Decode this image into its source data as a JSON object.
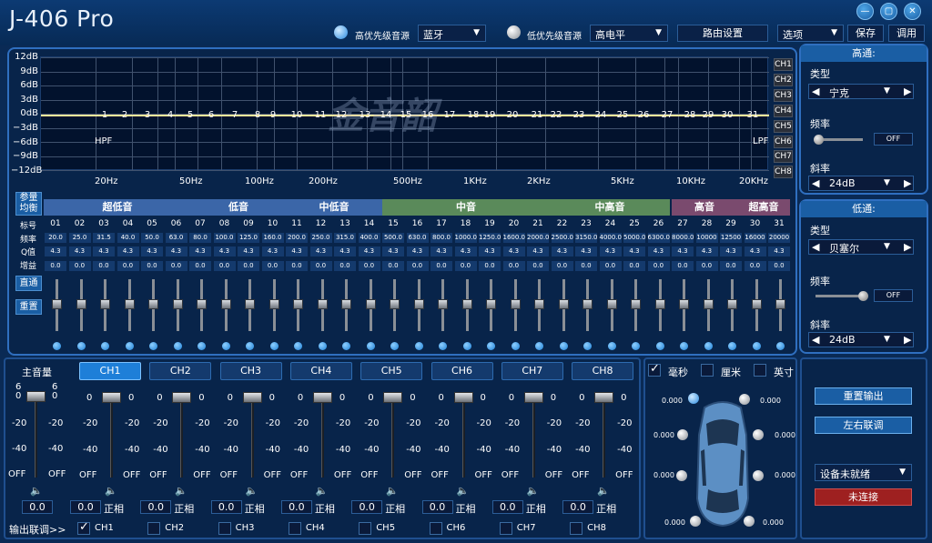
{
  "app": {
    "title": "J-406 Pro",
    "minimize": "—",
    "restore": "▢",
    "close": "✕"
  },
  "top": {
    "high_priority_label": "高优先级音源",
    "high_priority_value": "蓝牙",
    "low_priority_label": "低优先级音源",
    "low_priority_value": "高电平",
    "routing": "路由设置",
    "options": "选项",
    "save": "保存",
    "load": "调用"
  },
  "graph": {
    "watermark": "金音韶",
    "ylabels": [
      "12dB",
      "9dB",
      "6dB",
      "3dB",
      "0dB",
      "−3dB",
      "−6dB",
      "−9dB",
      "−12dB"
    ],
    "hpf": "HPF",
    "lpf": "LPF",
    "bands": [
      "1",
      "2",
      "3",
      "4",
      "5",
      "6",
      "7",
      "8",
      "9",
      "10",
      "11",
      "12",
      "13",
      "14",
      "15",
      "16",
      "17",
      "18",
      "19",
      "20",
      "21",
      "22",
      "23",
      "24",
      "25",
      "26",
      "27",
      "28",
      "29",
      "30",
      "31"
    ],
    "xlabels": [
      "20Hz",
      "50Hz",
      "100Hz",
      "200Hz",
      "500Hz",
      "1KHz",
      "2KHz",
      "5KHz",
      "10KHz",
      "20KHz"
    ],
    "channels": [
      "CH1",
      "CH2",
      "CH3",
      "CH4",
      "CH5",
      "CH6",
      "CH7",
      "CH8"
    ]
  },
  "eq": {
    "param_btn": "参量均衡",
    "direct_btn": "直通",
    "reset_btn": "重置",
    "groups": [
      "超低音",
      "低音",
      "中低音",
      "中音",
      "中高音",
      "高音",
      "超高音"
    ],
    "group_colors": [
      "#3b66a8",
      "#3b66a8",
      "#3b66a8",
      "#5a8a5a",
      "#5a8a5a",
      "#7a4a6e",
      "#7a4a6e"
    ],
    "row_labels": [
      "标号",
      "频率",
      "Q值",
      "增益"
    ],
    "numbers": [
      "01",
      "02",
      "03",
      "04",
      "05",
      "06",
      "07",
      "08",
      "09",
      "10",
      "11",
      "12",
      "13",
      "14",
      "15",
      "16",
      "17",
      "18",
      "19",
      "20",
      "21",
      "22",
      "23",
      "24",
      "25",
      "26",
      "27",
      "28",
      "29",
      "30",
      "31"
    ],
    "freqs": [
      "20.0",
      "25.0",
      "31.5",
      "40.0",
      "50.0",
      "63.0",
      "80.0",
      "100.0",
      "125.0",
      "160.0",
      "200.0",
      "250.0",
      "315.0",
      "400.0",
      "500.0",
      "630.0",
      "800.0",
      "1000.0",
      "1250.0",
      "1600.0",
      "2000.0",
      "2500.0",
      "3150.0",
      "4000.0",
      "5000.0",
      "6300.0",
      "8000.0",
      "10000",
      "12500",
      "16000",
      "20000"
    ],
    "q": "4.3",
    "gain": "0.0"
  },
  "highpass": {
    "title": "高通:",
    "type_label": "类型",
    "type_value": "宁克",
    "freq_label": "频率",
    "freq_value": "OFF",
    "slope_label": "斜率",
    "slope_value": "24dB"
  },
  "lowpass": {
    "title": "低通:",
    "type_label": "类型",
    "type_value": "贝塞尔",
    "freq_label": "频率",
    "freq_value": "OFF",
    "slope_label": "斜率",
    "slope_value": "24dB"
  },
  "mixer": {
    "master_label": "主音量",
    "master_value": "0.0",
    "master_scale": [
      "6",
      "0",
      "-20",
      "-40",
      "OFF"
    ],
    "scale": [
      "0",
      "-20",
      "-40",
      "OFF"
    ],
    "channels": [
      "CH1",
      "CH2",
      "CH3",
      "CH4",
      "CH5",
      "CH6",
      "CH7",
      "CH8"
    ],
    "values": [
      "0.0",
      "0.0",
      "0.0",
      "0.0",
      "0.0",
      "0.0",
      "0.0",
      "0.0"
    ],
    "phase": "正相",
    "link_label": "输出联调>>",
    "link_checks": [
      "CH1",
      "CH2",
      "CH3",
      "CH4",
      "CH5",
      "CH6",
      "CH7",
      "CH8"
    ]
  },
  "delay": {
    "units": [
      "毫秒",
      "厘米",
      "英寸"
    ],
    "values": [
      "0.000",
      "0.000",
      "0.000",
      "0.000",
      "0.000",
      "0.000",
      "0.000",
      "0.000",
      "0.000",
      "0.000"
    ]
  },
  "device": {
    "reset_output": "重置输出",
    "lr_link": "左右联调",
    "status": "设备未就绪",
    "connect": "未连接"
  }
}
